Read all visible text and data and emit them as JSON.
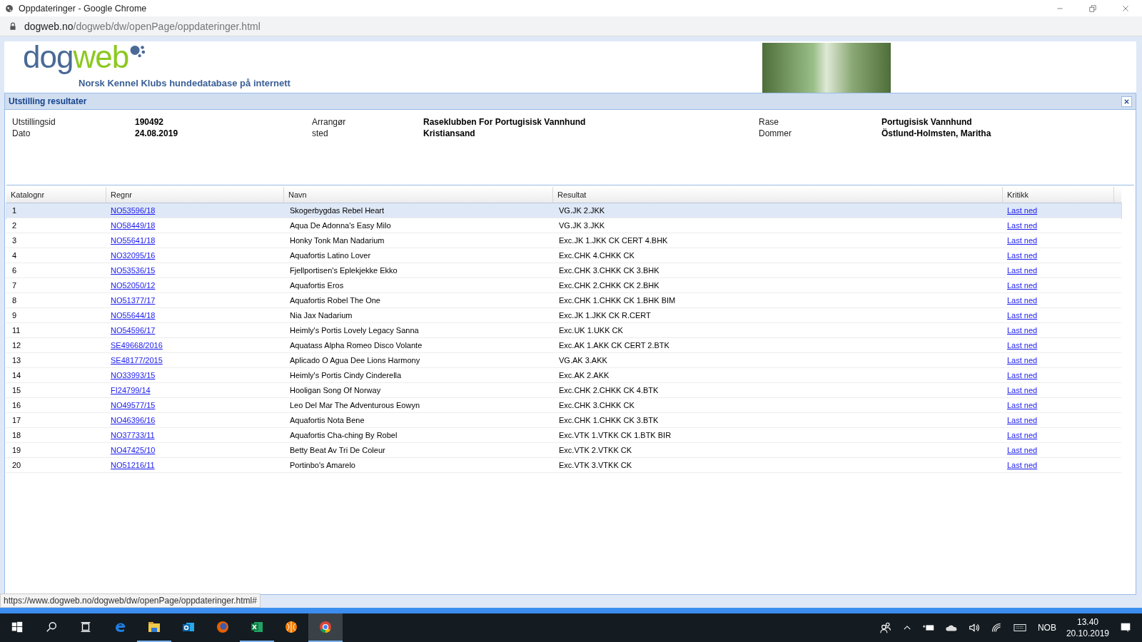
{
  "window": {
    "title": "Oppdateringer - Google Chrome"
  },
  "address_bar": {
    "host": "dogweb.no",
    "path": "/dogweb/dw/openPage/oppdateringer.html"
  },
  "site_header": {
    "logo_part_1": "dog",
    "logo_part_2": "web",
    "tagline": "Norsk Kennel Klubs hundedatabase på internett"
  },
  "dialog": {
    "title": "Utstilling resultater",
    "info": [
      {
        "label": "Utstillingsid",
        "value": "190492"
      },
      {
        "label": "Dato",
        "value": "24.08.2019"
      },
      {
        "label": "Arrangør",
        "value": "Raseklubben For Portugisisk Vannhund"
      },
      {
        "label": "sted",
        "value": "Kristiansand"
      },
      {
        "label": "Rase",
        "value": "Portugisisk Vannhund"
      },
      {
        "label": "Dommer",
        "value": "Östlund-Holmsten, Maritha"
      }
    ],
    "table": {
      "columns": [
        "Katalognr",
        "Regnr",
        "Navn",
        "Resultat",
        "Kritikk"
      ],
      "rows": [
        {
          "katalognr": "1",
          "regnr": "NO53596/18",
          "navn": "Skogerbygdas Rebel Heart",
          "resultat": "VG.JK 2.JKK",
          "kritikk": "Last ned",
          "selected": true
        },
        {
          "katalognr": "2",
          "regnr": "NO58449/18",
          "navn": "Aqua De Adonna's Easy Milo",
          "resultat": "VG.JK 3.JKK",
          "kritikk": "Last ned",
          "selected": false
        },
        {
          "katalognr": "3",
          "regnr": "NO55641/18",
          "navn": "Honky Tonk Man Nadarium",
          "resultat": "Exc.JK 1.JKK CK CERT 4.BHK",
          "kritikk": "Last ned",
          "selected": false
        },
        {
          "katalognr": "4",
          "regnr": "NO32095/16",
          "navn": "Aquafortis Latino Lover",
          "resultat": "Exc.CHK 4.CHKK CK",
          "kritikk": "Last ned",
          "selected": false
        },
        {
          "katalognr": "6",
          "regnr": "NO53536/15",
          "navn": "Fjellportisen's Eplekjekke Ekko",
          "resultat": "Exc.CHK 3.CHKK CK 3.BHK",
          "kritikk": "Last ned",
          "selected": false
        },
        {
          "katalognr": "7",
          "regnr": "NO52050/12",
          "navn": "Aquafortis Eros",
          "resultat": "Exc.CHK 2.CHKK CK 2.BHK",
          "kritikk": "Last ned",
          "selected": false
        },
        {
          "katalognr": "8",
          "regnr": "NO51377/17",
          "navn": "Aquafortis Robel The One",
          "resultat": "Exc.CHK 1.CHKK CK 1.BHK BIM",
          "kritikk": "Last ned",
          "selected": false
        },
        {
          "katalognr": "9",
          "regnr": "NO55644/18",
          "navn": "Nia Jax Nadarium",
          "resultat": "Exc.JK 1.JKK CK R.CERT",
          "kritikk": "Last ned",
          "selected": false
        },
        {
          "katalognr": "11",
          "regnr": "NO54596/17",
          "navn": "Heimly's Portis Lovely Legacy Sanna",
          "resultat": "Exc.UK 1.UKK CK",
          "kritikk": "Last ned",
          "selected": false
        },
        {
          "katalognr": "12",
          "regnr": "SE49668/2016",
          "navn": "Aquatass Alpha Romeo Disco Volante",
          "resultat": "Exc.AK 1.AKK CK CERT 2.BTK",
          "kritikk": "Last ned",
          "selected": false
        },
        {
          "katalognr": "13",
          "regnr": "SE48177/2015",
          "navn": "Aplicado O Agua Dee Lions Harmony",
          "resultat": "VG.AK 3.AKK",
          "kritikk": "Last ned",
          "selected": false
        },
        {
          "katalognr": "14",
          "regnr": "NO33993/15",
          "navn": "Heimly's Portis Cindy Cinderella",
          "resultat": "Exc.AK 2.AKK",
          "kritikk": "Last ned",
          "selected": false
        },
        {
          "katalognr": "15",
          "regnr": "FI24799/14",
          "navn": "Hooligan Song Of Norway",
          "resultat": "Exc.CHK 2.CHKK CK 4.BTK",
          "kritikk": "Last ned",
          "selected": false
        },
        {
          "katalognr": "16",
          "regnr": "NO49577/15",
          "navn": "Leo Del Mar The Adventurous Eowyn",
          "resultat": "Exc.CHK 3.CHKK CK",
          "kritikk": "Last ned",
          "selected": false
        },
        {
          "katalognr": "17",
          "regnr": "NO46396/16",
          "navn": "Aquafortis Nota Bene",
          "resultat": "Exc.CHK 1.CHKK CK 3.BTK",
          "kritikk": "Last ned",
          "selected": false
        },
        {
          "katalognr": "18",
          "regnr": "NO37733/11",
          "navn": "Aquafortis Cha-ching By Robel",
          "resultat": "Exc.VTK 1.VTKK CK 1.BTK BIR",
          "kritikk": "Last ned",
          "selected": false
        },
        {
          "katalognr": "19",
          "regnr": "NO47425/10",
          "navn": "Betty Beat Av Tri De Coleur",
          "resultat": "Exc.VTK 2.VTKK CK",
          "kritikk": "Last ned",
          "selected": false
        },
        {
          "katalognr": "20",
          "regnr": "NO51216/11",
          "navn": "Portinbo's Amarelo",
          "resultat": "Exc.VTK 3.VTKK CK",
          "kritikk": "Last ned",
          "selected": false
        }
      ]
    }
  },
  "status_url": "https://www.dogweb.no/dogweb/dw/openPage/oppdateringer.html#",
  "taskbar": {
    "apps": [
      {
        "kind": "edge",
        "running": false,
        "selected": false
      },
      {
        "kind": "explorer",
        "running": true,
        "selected": false
      },
      {
        "kind": "outlook",
        "running": false,
        "selected": false
      },
      {
        "kind": "firefox",
        "running": false,
        "selected": false
      },
      {
        "kind": "excel",
        "running": true,
        "selected": false
      },
      {
        "kind": "orange",
        "running": false,
        "selected": false
      },
      {
        "kind": "chrome",
        "running": true,
        "selected": true
      }
    ],
    "language": "NOB",
    "time": "13.40",
    "date": "20.10.2019"
  }
}
